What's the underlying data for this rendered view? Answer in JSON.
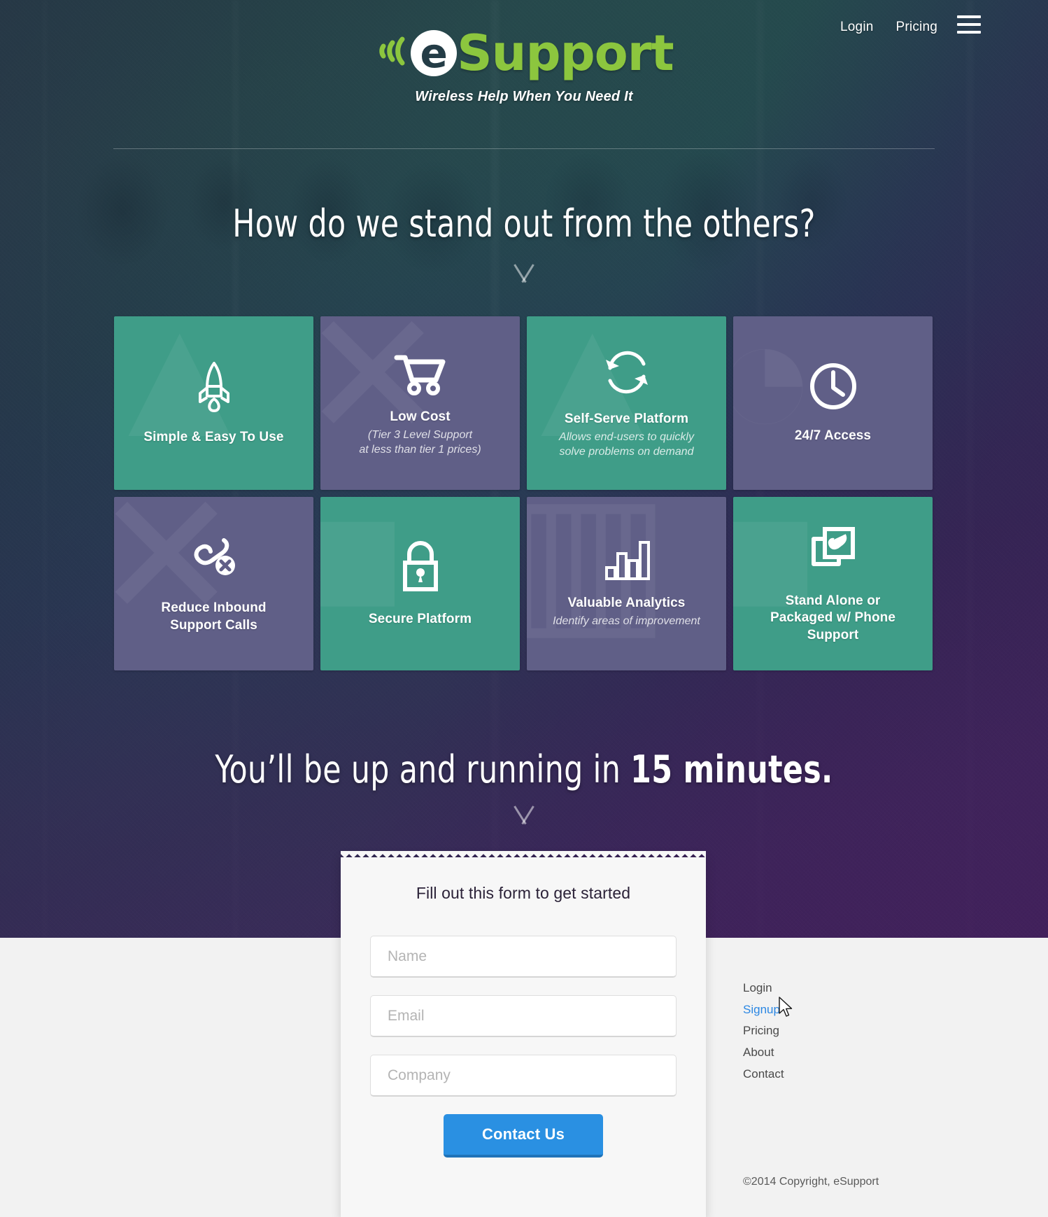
{
  "brand": {
    "logo_mark": "e",
    "logo_word": "Support",
    "tagline": "Wireless Help When You Need It",
    "accent_green": "#8cc63e",
    "teal_tile": "#3f9d88",
    "purple_tile": "#605f87",
    "button_blue": "#2a90e2",
    "link_blue": "#2b87e3"
  },
  "topnav": {
    "items": [
      {
        "label": "Login"
      },
      {
        "label": "Pricing"
      }
    ],
    "menu_icon": "hamburger-icon"
  },
  "hero": {
    "heading_standout": "How do we stand out from the others?",
    "heading_minutes_prefix": "You’ll be up and running in ",
    "heading_minutes_strong": "15 minutes.",
    "scroll_icon": "chevron-down-icon"
  },
  "tiles": [
    {
      "title": "Simple & Easy To Use",
      "sub": "",
      "color": "teal",
      "icon": "rocket-icon",
      "watermark": "▲"
    },
    {
      "title": "Low Cost",
      "sub": "(Tier 3 Level Support\nat less than tier 1 prices)",
      "color": "purple",
      "icon": "shopping-cart-icon",
      "watermark": "✕"
    },
    {
      "title": "Self-Serve Platform",
      "sub": "Allows end-users to quickly\nsolve problems on demand",
      "color": "teal",
      "icon": "refresh-cycle-icon",
      "watermark": "▲"
    },
    {
      "title": "24/7 Access",
      "sub": "",
      "color": "purple",
      "icon": "clock-icon",
      "watermark": "◔"
    },
    {
      "title": "Reduce Inbound\nSupport Calls",
      "sub": "",
      "color": "purple",
      "icon": "phone-cancel-icon",
      "watermark": "✕"
    },
    {
      "title": "Secure Platform",
      "sub": "",
      "color": "teal",
      "icon": "padlock-icon",
      "watermark": "■"
    },
    {
      "title": "Valuable Analytics",
      "sub": "Identify areas of improvement",
      "color": "purple",
      "icon": "bar-chart-icon",
      "watermark": "▥"
    },
    {
      "title": "Stand Alone or\nPackaged w/ Phone Support",
      "sub": "",
      "color": "teal",
      "icon": "phone-window-icon",
      "watermark": "■"
    }
  ],
  "form": {
    "title": "Fill out this form to get started",
    "name_placeholder": "Name",
    "name_value": "",
    "email_placeholder": "Email",
    "email_value": "",
    "company_placeholder": "Company",
    "company_value": "",
    "submit_label": "Contact Us"
  },
  "footer": {
    "links": [
      {
        "label": "Login",
        "active": false
      },
      {
        "label": "Signup",
        "active": true
      },
      {
        "label": "Pricing",
        "active": false
      },
      {
        "label": "About",
        "active": false
      },
      {
        "label": "Contact",
        "active": false
      }
    ],
    "copyright": "©2014 Copyright, eSupport"
  }
}
